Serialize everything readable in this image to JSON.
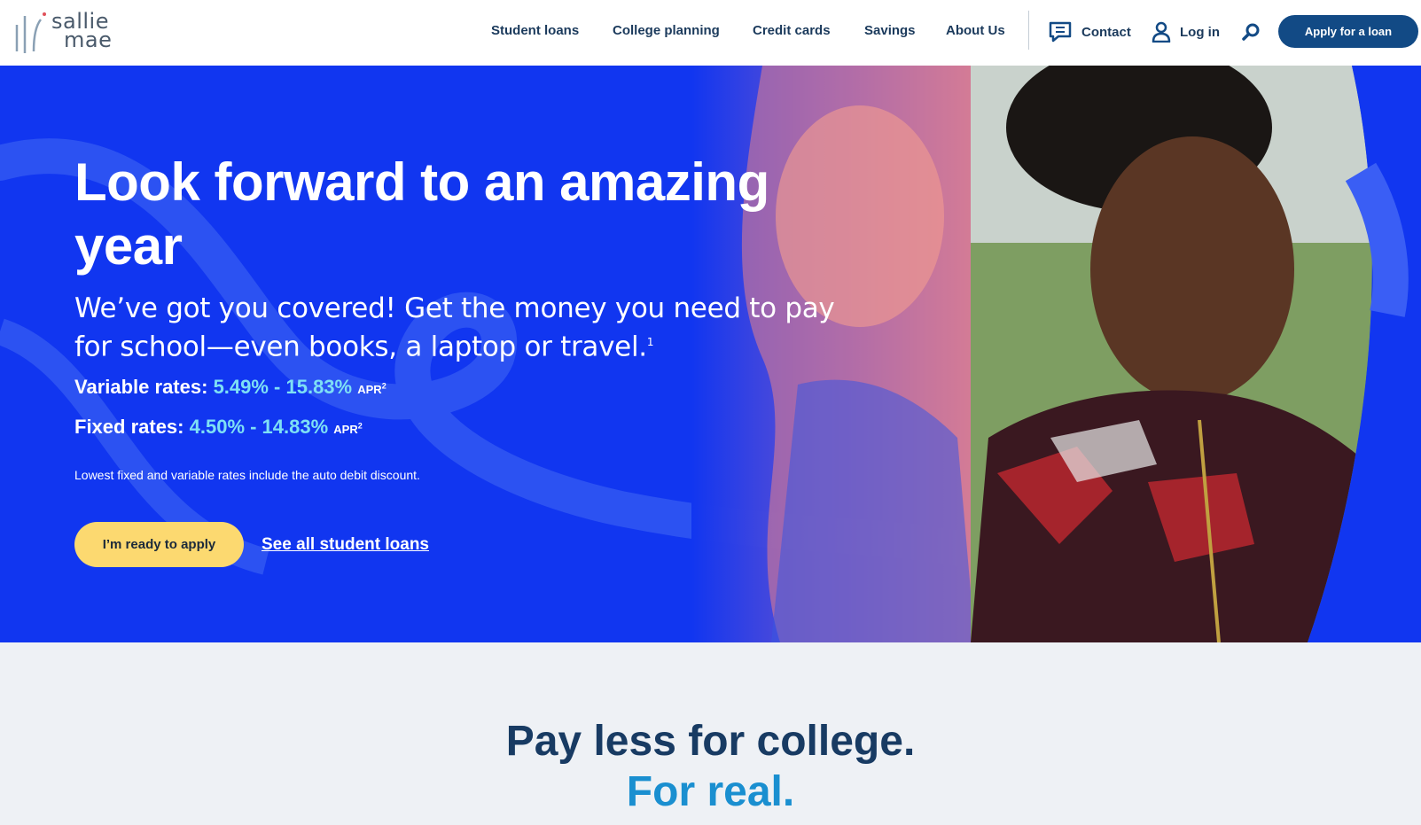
{
  "brand": {
    "line1": "sallie",
    "line2": "mae"
  },
  "nav": {
    "items": [
      {
        "label": "Student loans"
      },
      {
        "label": "College planning"
      },
      {
        "label": "Credit cards"
      },
      {
        "label": "Savings"
      },
      {
        "label": "About Us"
      }
    ],
    "contact": "Contact",
    "login": "Log in",
    "apply": "Apply for a loan"
  },
  "hero": {
    "title": "Look forward to an amazing year",
    "subtitle": "We’ve got you covered! Get the money you need to pay for school—even books, a laptop or travel.",
    "subtitle_footnote": "1",
    "variable": {
      "label": "Variable rates:",
      "value": "5.49% - 15.83%",
      "apr": "APR",
      "footnote": "2"
    },
    "fixed": {
      "label": "Fixed rates:",
      "value": "4.50% - 14.83%",
      "apr": "APR",
      "footnote": "2"
    },
    "disclaimer": "Lowest fixed and variable rates include the auto debit discount.",
    "cta": "I’m ready to apply",
    "link": "See all student loans"
  },
  "bottom": {
    "line1": "Pay less for college.",
    "line2": "For real."
  },
  "colors": {
    "navy": "#124a85",
    "hero_blue": "#1136f0",
    "rate_cyan": "#7ee0f5",
    "cta_yellow": "#fcd970",
    "accent_blue": "#1a8fd0"
  },
  "icons": [
    "sallie-mae-logo-icon",
    "chat-icon",
    "user-icon",
    "search-icon"
  ]
}
